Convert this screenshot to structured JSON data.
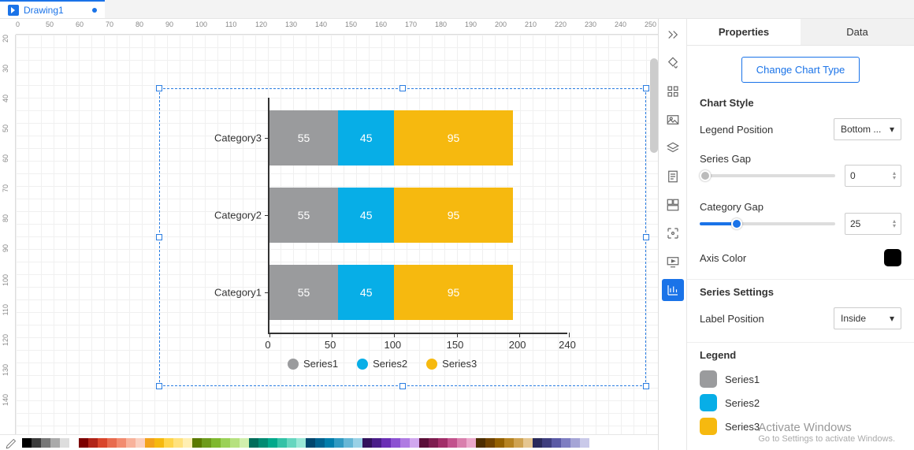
{
  "tab": {
    "name": "Drawing1"
  },
  "ruler_h": [
    0,
    50,
    60,
    70,
    80,
    90,
    100,
    110,
    120,
    130,
    140,
    150,
    160,
    170,
    180,
    190,
    200,
    210,
    220,
    230,
    240,
    250
  ],
  "ruler_v": [
    20,
    30,
    40,
    50,
    60,
    70,
    80,
    90,
    100,
    110,
    120,
    130,
    140
  ],
  "chart_data": {
    "type": "bar",
    "orientation": "horizontal-stacked",
    "categories": [
      "Category3",
      "Category2",
      "Category1"
    ],
    "series": [
      {
        "name": "Series1",
        "color": "#9a9b9d",
        "values": [
          55,
          55,
          55
        ]
      },
      {
        "name": "Series2",
        "color": "#07aee7",
        "values": [
          45,
          45,
          45
        ]
      },
      {
        "name": "Series3",
        "color": "#f6b90f",
        "values": [
          95,
          95,
          95
        ]
      }
    ],
    "x_ticks": [
      0,
      50,
      100,
      150,
      200,
      240
    ],
    "xlim": [
      0,
      240
    ],
    "legend_position": "bottom"
  },
  "panel": {
    "tabs": {
      "properties": "Properties",
      "data": "Data"
    },
    "change_btn": "Change Chart Type",
    "chart_style": "Chart Style",
    "legend_position_label": "Legend Position",
    "legend_position_value": "Bottom ...",
    "series_gap_label": "Series Gap",
    "series_gap_value": "0",
    "category_gap_label": "Category Gap",
    "category_gap_value": "25",
    "axis_color_label": "Axis Color",
    "axis_color": "#000000",
    "series_settings": "Series Settings",
    "label_position_label": "Label Position",
    "label_position_value": "Inside",
    "legend_title": "Legend",
    "legend_items": [
      {
        "name": "Series1",
        "color": "#9a9b9d"
      },
      {
        "name": "Series2",
        "color": "#07aee7"
      },
      {
        "name": "Series3",
        "color": "#f6b90f"
      }
    ]
  },
  "watermark": {
    "line1": "Activate Windows",
    "line2": "Go to Settings to activate Windows."
  },
  "palette": [
    "#000",
    "#3b3b3b",
    "#777",
    "#aaa",
    "#ddd",
    "#fff",
    "#7c0000",
    "#b02418",
    "#d9452b",
    "#e86b4e",
    "#f28b6f",
    "#f8b29b",
    "#fad0c0",
    "#f3a21b",
    "#f6b90f",
    "#ffd54a",
    "#ffe27e",
    "#ffefb2",
    "#5a7a00",
    "#6d9b1c",
    "#7fb82f",
    "#9ad157",
    "#b6e17f",
    "#d1efad",
    "#006d5a",
    "#008b72",
    "#00a98b",
    "#33c2a6",
    "#66d6bf",
    "#99e7d6",
    "#00476e",
    "#00628f",
    "#007dab",
    "#309ac2",
    "#66b7d6",
    "#99d1e6",
    "#32125c",
    "#4a1e89",
    "#6a2fb5",
    "#8c52d2",
    "#af7be2",
    "#d1a8ef",
    "#5b0f3a",
    "#7d1d50",
    "#a12e69",
    "#c2528d",
    "#d97fad",
    "#eba8cb",
    "#4d2e00",
    "#704300",
    "#936000",
    "#b68322",
    "#cfa352",
    "#e5c690",
    "#2a2a5a",
    "#3e3e7e",
    "#5a5aa5",
    "#7e7ec2",
    "#a5a5d6",
    "#c9c9e9"
  ]
}
